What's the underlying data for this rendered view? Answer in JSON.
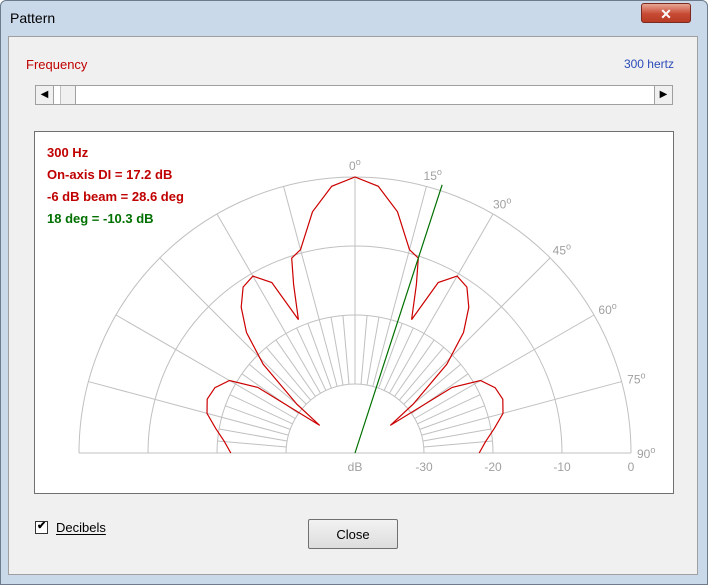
{
  "window": {
    "title": "Pattern",
    "close_glyph": "✕"
  },
  "frequency": {
    "label": "Frequency",
    "value": "300 hertz",
    "slider_position": 0.01
  },
  "scroll": {
    "left_glyph": "◀",
    "right_glyph": "▶"
  },
  "plot": {
    "info_lines": [
      {
        "text": "300 Hz",
        "color": "#c00000"
      },
      {
        "text": "On-axis DI = 17.2 dB",
        "color": "#c00000"
      },
      {
        "text": "-6 dB beam = 28.6 deg",
        "color": "#c00000"
      },
      {
        "text": "18 deg = -10.3 dB",
        "color": "#007000"
      }
    ],
    "angle_labels": [
      "0",
      "15",
      "30",
      "45",
      "60",
      "75",
      "90"
    ],
    "db_labels": [
      "dB",
      "-30",
      "-20",
      "-10",
      "0"
    ],
    "degree_symbol": "o",
    "pattern_color": "#cc0000",
    "marker_color": "#007000",
    "grid_color": "#c0c0c0"
  },
  "chart_data": {
    "type": "polar",
    "angle_ticks_deg": [
      0,
      15,
      30,
      45,
      60,
      75,
      90
    ],
    "radius_ticks_db": [
      -40,
      -30,
      -20,
      -10,
      0
    ],
    "marker_angle_deg": 18,
    "marker_level_db": -10.3,
    "pattern_db": [
      [
        0,
        0.0
      ],
      [
        5,
        -1.2
      ],
      [
        10,
        -4.5
      ],
      [
        15,
        -9.5
      ],
      [
        18,
        -10.3
      ],
      [
        20,
        -14.0
      ],
      [
        23,
        -19.0
      ],
      [
        26,
        -12.5
      ],
      [
        30,
        -10.4
      ],
      [
        34,
        -11.0
      ],
      [
        38,
        -13.2
      ],
      [
        42,
        -16.5
      ],
      [
        46,
        -21.5
      ],
      [
        50,
        -29.0
      ],
      [
        52,
        -33.5
      ],
      [
        56,
        -23.0
      ],
      [
        60,
        -19.0
      ],
      [
        65,
        -17.6
      ],
      [
        70,
        -17.2
      ],
      [
        75,
        -17.8
      ],
      [
        80,
        -19.5
      ],
      [
        85,
        -21.0
      ],
      [
        90,
        -22.0
      ]
    ]
  },
  "options": {
    "decibels_label": "Decibels",
    "decibels_checked": true,
    "check_glyph": "✔"
  },
  "buttons": {
    "close_label": "Close"
  }
}
